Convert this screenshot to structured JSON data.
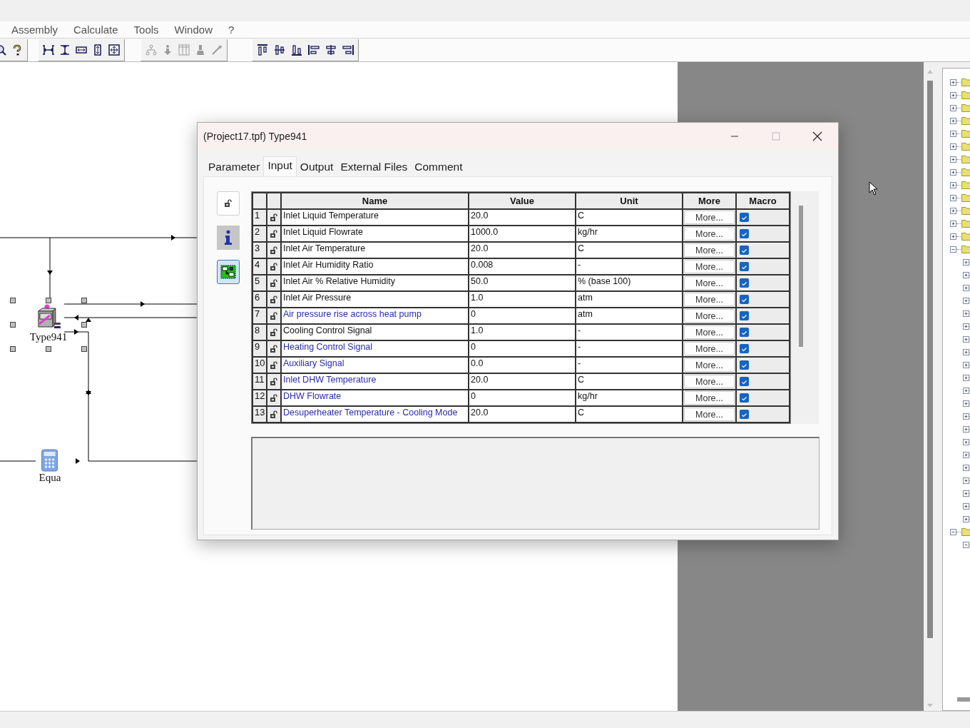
{
  "menu": [
    {
      "label": "Assembly"
    },
    {
      "label": "Calculate"
    },
    {
      "label": "Tools"
    },
    {
      "label": "Window"
    },
    {
      "label": "?"
    }
  ],
  "toolbar": [
    {
      "items": [
        {
          "kind": "magnifier",
          "disabled": false
        },
        {
          "kind": "question-mark",
          "disabled": false
        }
      ]
    },
    {
      "items": [
        {
          "kind": "horizontal-spacing",
          "disabled": false
        },
        {
          "kind": "vertical-spacing",
          "disabled": false
        },
        {
          "kind": "horizontal-arrows",
          "disabled": false
        },
        {
          "kind": "vertical-arrows",
          "disabled": false
        },
        {
          "kind": "four-arrows",
          "disabled": false
        }
      ]
    },
    {
      "items": [
        {
          "kind": "hierarchy",
          "disabled": true
        },
        {
          "kind": "down-arrow",
          "disabled": true
        },
        {
          "kind": "columns",
          "disabled": true
        },
        {
          "kind": "brush",
          "disabled": true
        },
        {
          "kind": "wand",
          "disabled": true
        }
      ]
    },
    {
      "items": [
        {
          "kind": "align-top",
          "disabled": false
        },
        {
          "kind": "align-middle",
          "disabled": false
        },
        {
          "kind": "align-bottom",
          "disabled": false
        },
        {
          "kind": "align-left",
          "disabled": false
        },
        {
          "kind": "align-center",
          "disabled": false
        },
        {
          "kind": "align-right",
          "disabled": false
        }
      ]
    }
  ],
  "components": [
    {
      "label": "Type941",
      "kind": "device",
      "selected": true
    },
    {
      "label": "Equa",
      "kind": "calculator",
      "selected": false
    }
  ],
  "dialog": {
    "title": "(Project17.tpf) Type941",
    "tabs": [
      {
        "label": "Parameter",
        "selected": false
      },
      {
        "label": "Input",
        "selected": true
      },
      {
        "label": "Output",
        "selected": false
      },
      {
        "label": "External Files",
        "selected": false
      },
      {
        "label": "Comment",
        "selected": false
      }
    ],
    "side_buttons": [
      {
        "kind": "lock",
        "selected": false
      },
      {
        "kind": "info",
        "selected": false
      },
      {
        "kind": "diagram",
        "selected": true
      }
    ],
    "columns": [
      "Name",
      "Value",
      "Unit",
      "More",
      "Macro"
    ],
    "rows": [
      {
        "index": "1",
        "name": "Inlet Liquid Temperature",
        "linked": false,
        "value": "20.0",
        "unit": "C",
        "more": "More...",
        "macro": true
      },
      {
        "index": "2",
        "name": "Inlet Liquid Flowrate",
        "linked": false,
        "value": "1000.0",
        "unit": "kg/hr",
        "more": "More...",
        "macro": true
      },
      {
        "index": "3",
        "name": "Inlet Air Temperature",
        "linked": false,
        "value": "20.0",
        "unit": "C",
        "more": "More...",
        "macro": true
      },
      {
        "index": "4",
        "name": "Inlet Air Humidity Ratio",
        "linked": false,
        "value": "0.008",
        "unit": "-",
        "more": "More...",
        "macro": true
      },
      {
        "index": "5",
        "name": "Inlet Air % Relative Humidity",
        "linked": false,
        "value": "50.0",
        "unit": "% (base 100)",
        "more": "More...",
        "macro": true
      },
      {
        "index": "6",
        "name": "Inlet Air Pressure",
        "linked": false,
        "value": "1.0",
        "unit": "atm",
        "more": "More...",
        "macro": true
      },
      {
        "index": "7",
        "name": "Air pressure rise across heat pump",
        "linked": true,
        "value": "0",
        "unit": "atm",
        "more": "More...",
        "macro": true
      },
      {
        "index": "8",
        "name": "Cooling Control Signal",
        "linked": false,
        "value": "1.0",
        "unit": "-",
        "more": "More...",
        "macro": true
      },
      {
        "index": "9",
        "name": "Heating Control Signal",
        "linked": true,
        "value": "0",
        "unit": "-",
        "more": "More...",
        "macro": true
      },
      {
        "index": "10",
        "name": "Auxiliary Signal",
        "linked": true,
        "value": "0.0",
        "unit": "-",
        "more": "More...",
        "macro": true
      },
      {
        "index": "11",
        "name": "Inlet DHW Temperature",
        "linked": true,
        "value": "20.0",
        "unit": "C",
        "more": "More...",
        "macro": true
      },
      {
        "index": "12",
        "name": "DHW Flowrate",
        "linked": true,
        "value": "0",
        "unit": "kg/hr",
        "more": "More...",
        "macro": true
      },
      {
        "index": "13",
        "name": "Desuperheater Temperature - Cooling Mode",
        "linked": true,
        "value": "20.0",
        "unit": "C",
        "more": "More...",
        "macro": true
      }
    ]
  },
  "tree": [
    {
      "expanded": false
    },
    {
      "expanded": false
    },
    {
      "expanded": false
    },
    {
      "expanded": false
    },
    {
      "expanded": false
    },
    {
      "expanded": false
    },
    {
      "expanded": false
    },
    {
      "expanded": false
    },
    {
      "expanded": false
    },
    {
      "expanded": false
    },
    {
      "expanded": false
    },
    {
      "expanded": false
    },
    {
      "expanded": false
    },
    {
      "expanded": true,
      "children": [
        {
          "expanded": false
        },
        {
          "expanded": false
        },
        {
          "expanded": false
        },
        {
          "expanded": false
        },
        {
          "expanded": false
        },
        {
          "expanded": false
        },
        {
          "expanded": false
        },
        {
          "expanded": false
        },
        {
          "expanded": false
        },
        {
          "expanded": false
        },
        {
          "expanded": false
        },
        {
          "expanded": false
        },
        {
          "expanded": false
        },
        {
          "expanded": false
        },
        {
          "expanded": false
        },
        {
          "expanded": false
        },
        {
          "expanded": false
        },
        {
          "expanded": false
        },
        {
          "expanded": false
        },
        {
          "expanded": false
        },
        {
          "expanded": false
        }
      ]
    },
    {
      "expanded": true,
      "children": [
        {
          "expanded": true
        }
      ]
    }
  ]
}
